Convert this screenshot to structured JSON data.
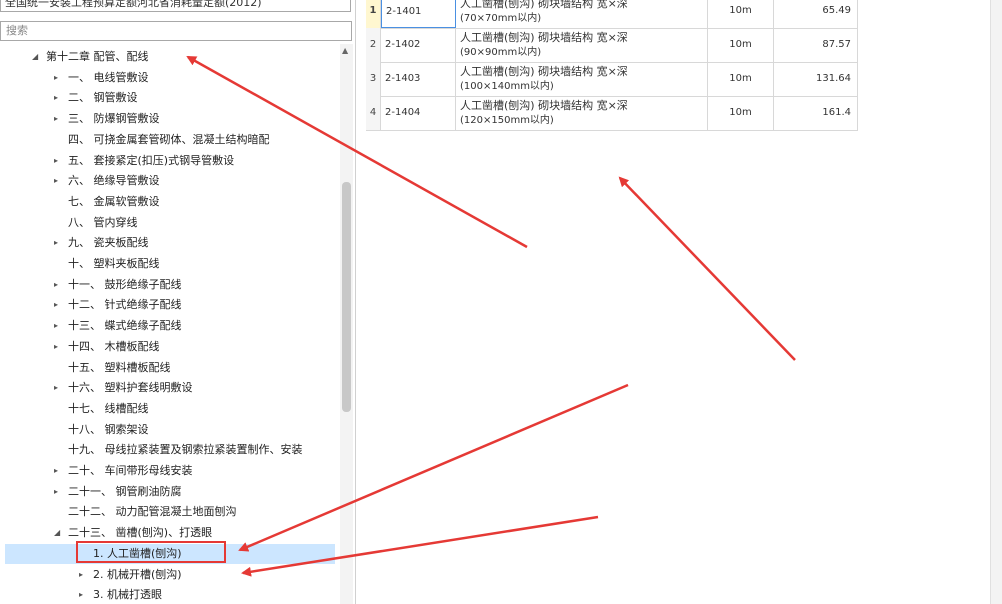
{
  "library_select": "全国统一安装工程预算定额河北省消耗量定额(2012)",
  "search": {
    "placeholder": "搜索"
  },
  "tree": [
    {
      "level": 0,
      "expanded": true,
      "label": "第十二章 配管、配线"
    },
    {
      "level": 1,
      "arrow": true,
      "label": "一、 电线管敷设"
    },
    {
      "level": 1,
      "arrow": true,
      "label": "二、 钢管敷设"
    },
    {
      "level": 1,
      "arrow": true,
      "label": "三、 防爆钢管敷设"
    },
    {
      "level": 1,
      "arrow": false,
      "label": "四、 可挠金属套管砌体、混凝土结构暗配"
    },
    {
      "level": 1,
      "arrow": true,
      "label": "五、 套接紧定(扣压)式钢导管敷设"
    },
    {
      "level": 1,
      "arrow": true,
      "label": "六、 绝缘导管敷设"
    },
    {
      "level": 1,
      "arrow": false,
      "label": "七、 金属软管敷设"
    },
    {
      "level": 1,
      "arrow": false,
      "label": "八、 管内穿线"
    },
    {
      "level": 1,
      "arrow": true,
      "label": "九、 瓷夹板配线"
    },
    {
      "level": 1,
      "arrow": false,
      "label": "十、 塑料夹板配线"
    },
    {
      "level": 1,
      "arrow": true,
      "label": "十一、 鼓形绝缘子配线"
    },
    {
      "level": 1,
      "arrow": true,
      "label": "十二、 针式绝缘子配线"
    },
    {
      "level": 1,
      "arrow": true,
      "label": "十三、 蝶式绝缘子配线"
    },
    {
      "level": 1,
      "arrow": true,
      "label": "十四、 木槽板配线"
    },
    {
      "level": 1,
      "arrow": false,
      "label": "十五、 塑料槽板配线"
    },
    {
      "level": 1,
      "arrow": true,
      "label": "十六、 塑料护套线明敷设"
    },
    {
      "level": 1,
      "arrow": false,
      "label": "十七、 线槽配线"
    },
    {
      "level": 1,
      "arrow": false,
      "label": "十八、 钢索架设"
    },
    {
      "level": 1,
      "arrow": false,
      "label": "十九、 母线拉紧装置及钢索拉紧装置制作、安装"
    },
    {
      "level": 1,
      "arrow": true,
      "label": "二十、 车间带形母线安装"
    },
    {
      "level": 1,
      "arrow": true,
      "label": "二十一、 钢管刷油防腐"
    },
    {
      "level": 1,
      "arrow": false,
      "label": "二十二、 动力配管混凝土地面刨沟"
    },
    {
      "level": 1,
      "expanded": true,
      "label": "二十三、 凿槽(刨沟)、打透眼"
    },
    {
      "level": 2,
      "selected": true,
      "label": "1. 人工凿槽(刨沟)"
    },
    {
      "level": 2,
      "arrow": true,
      "label": "2. 机械开槽(刨沟)"
    },
    {
      "level": 2,
      "arrow": true,
      "label": "3. 机械打透眼"
    }
  ],
  "table": {
    "rows": [
      {
        "idx": "1",
        "code": "2-1401",
        "name": "人工凿槽(刨沟) 砌块墙结构 宽×深",
        "name2": "(70×70mm以内)",
        "unit": "10m",
        "price": "65.49",
        "selected": true
      },
      {
        "idx": "2",
        "code": "2-1402",
        "name": "人工凿槽(刨沟) 砌块墙结构 宽×深",
        "name2": "(90×90mm以内)",
        "unit": "10m",
        "price": "87.57"
      },
      {
        "idx": "3",
        "code": "2-1403",
        "name": "人工凿槽(刨沟) 砌块墙结构 宽×深",
        "name2": "(100×140mm以内)",
        "unit": "10m",
        "price": "131.64"
      },
      {
        "idx": "4",
        "code": "2-1404",
        "name": "人工凿槽(刨沟) 砌块墙结构 宽×深",
        "name2": "(120×150mm以内)",
        "unit": "10m",
        "price": "161.4"
      }
    ]
  },
  "colors": {
    "arrow": "#e53935",
    "selection": "#cce6ff",
    "highlight_border": "#e53935"
  }
}
